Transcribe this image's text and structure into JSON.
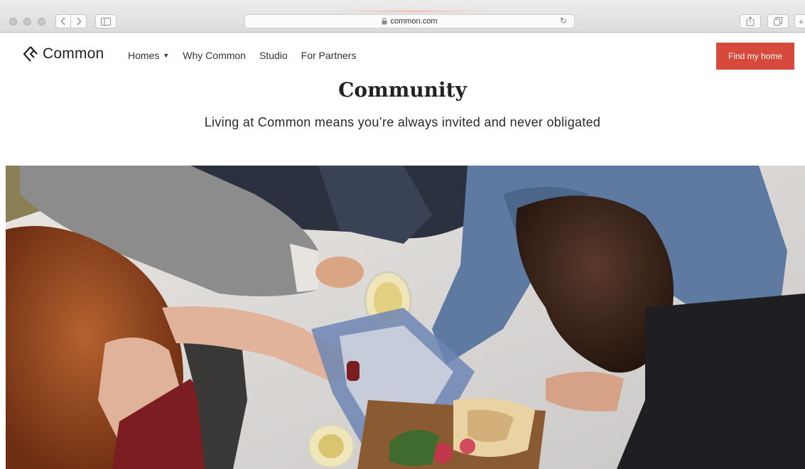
{
  "browser": {
    "url": "common.com",
    "lock_icon": "lock-icon"
  },
  "site": {
    "logo_text": "Common",
    "nav": [
      {
        "label": "Homes",
        "has_dropdown": true
      },
      {
        "label": "Why Common"
      },
      {
        "label": "Studio"
      },
      {
        "label": "For Partners"
      }
    ],
    "cta_label": "Find my home",
    "cta_color": "#d6493b"
  },
  "hero": {
    "title": "Community",
    "subtitle": "Living at Common means you’re always invited and never obligated"
  }
}
